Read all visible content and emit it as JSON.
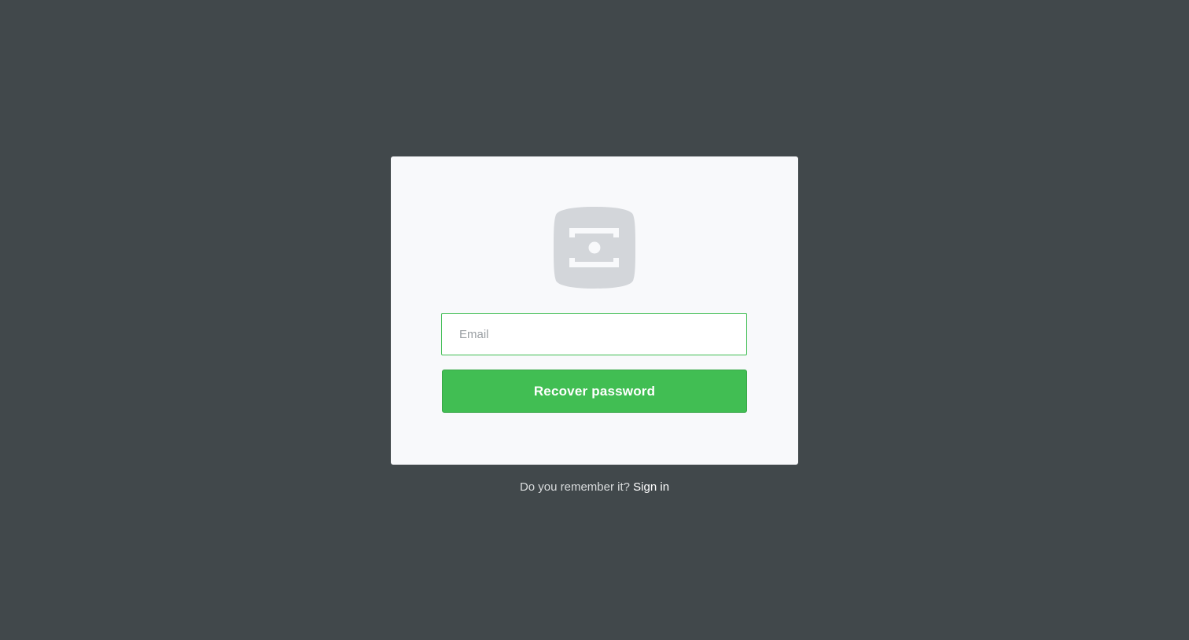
{
  "colors": {
    "background": "#41484b",
    "card": "#f8f9fb",
    "accent": "#41be53",
    "logo": "#d3d6da"
  },
  "logo": {
    "icon": "app-logo-icon"
  },
  "form": {
    "email_placeholder": "Email",
    "email_value": "",
    "submit_label": "Recover password"
  },
  "footer": {
    "prompt": "Do you remember it?",
    "link_label": "Sign in"
  }
}
